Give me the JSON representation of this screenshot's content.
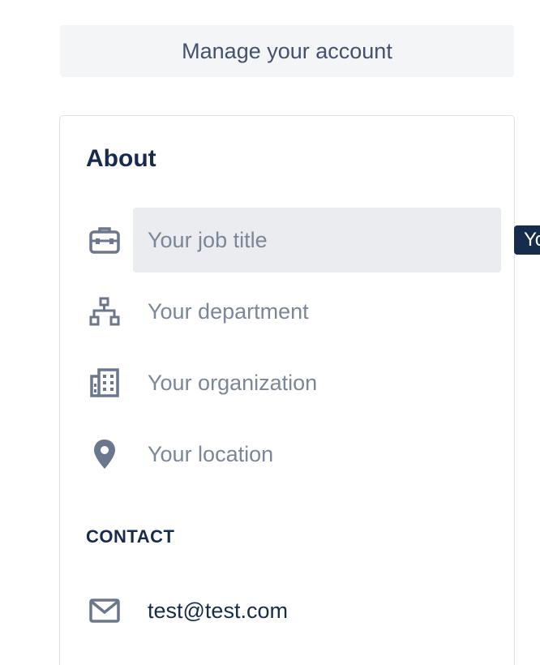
{
  "header": {
    "manage_account_label": "Manage your account"
  },
  "about": {
    "heading": "About",
    "fields": {
      "job_title": {
        "placeholder": "Your job title",
        "icon": "briefcase-icon"
      },
      "department": {
        "placeholder": "Your department",
        "icon": "org-chart-icon"
      },
      "organization": {
        "placeholder": "Your organization",
        "icon": "building-icon"
      },
      "location": {
        "placeholder": "Your location",
        "icon": "location-pin-icon"
      }
    }
  },
  "contact": {
    "heading": "CONTACT",
    "email": {
      "value": "test@test.com",
      "icon": "envelope-icon"
    }
  },
  "tooltip": {
    "text": "Yo"
  },
  "colors": {
    "text_primary": "#172b4d",
    "text_secondary": "#42526e",
    "placeholder": "#7a869a",
    "icon": "#6b778c",
    "field_active_bg": "#ebecf0",
    "button_bg": "#f4f5f7",
    "card_border": "#dfe1e6"
  }
}
